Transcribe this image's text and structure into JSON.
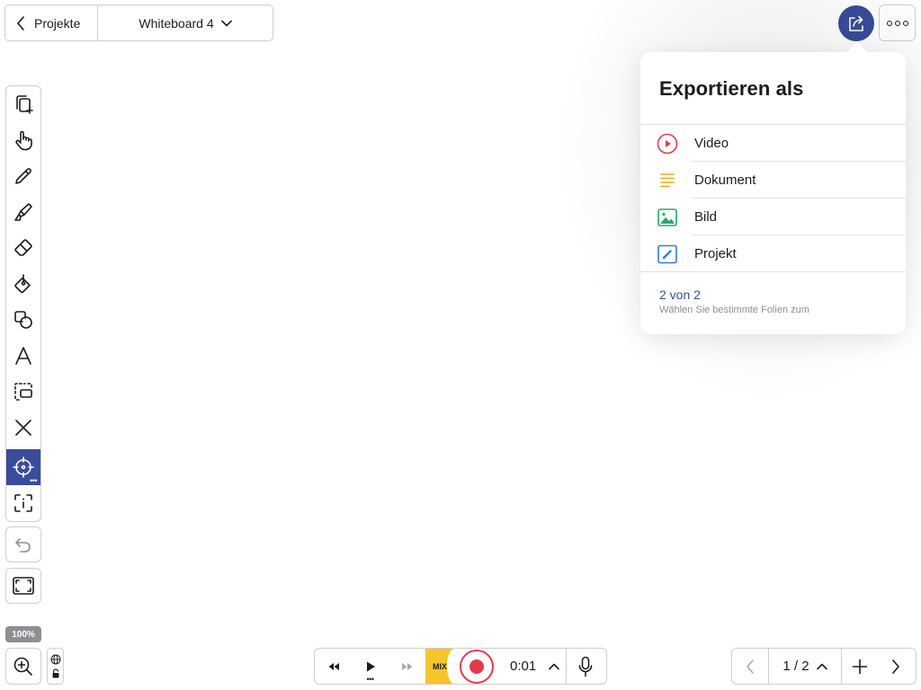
{
  "nav": {
    "back_label": "Projekte",
    "board_title": "Whiteboard 4"
  },
  "export": {
    "title": "Exportieren als",
    "items": [
      {
        "label": "Video",
        "icon": "play-circle-icon",
        "color": "#e5394b"
      },
      {
        "label": "Dokument",
        "icon": "document-lines-icon",
        "color": "#f0a818"
      },
      {
        "label": "Bild",
        "icon": "image-icon",
        "color": "#2ba56b"
      },
      {
        "label": "Projekt",
        "icon": "project-pen-icon",
        "color": "#2f7de1"
      }
    ],
    "pages_selected": "2 von 2",
    "pages_hint": "Wählen Sie bestimmte Folien zum"
  },
  "toolbar": {
    "tools": [
      {
        "name": "add-slide-icon"
      },
      {
        "name": "hand-icon"
      },
      {
        "name": "pen-icon"
      },
      {
        "name": "highlighter-icon"
      },
      {
        "name": "eraser-icon"
      },
      {
        "name": "fill-bucket-icon"
      },
      {
        "name": "shapes-icon"
      },
      {
        "name": "text-icon"
      },
      {
        "name": "selection-icon"
      },
      {
        "name": "close-x-icon"
      },
      {
        "name": "laser-pointer-icon",
        "active": true
      },
      {
        "name": "text-frame-icon"
      }
    ],
    "active_color": "#3a4c9a"
  },
  "zoom": {
    "level": "100%"
  },
  "player": {
    "mix_label": "MIX",
    "time": "0:01",
    "record_color": "#e5394b",
    "mix_color": "#f5c52a"
  },
  "pager": {
    "current": "1 / 2"
  },
  "colors": {
    "accent": "#3a4c9a",
    "border": "#cfcfd3"
  }
}
